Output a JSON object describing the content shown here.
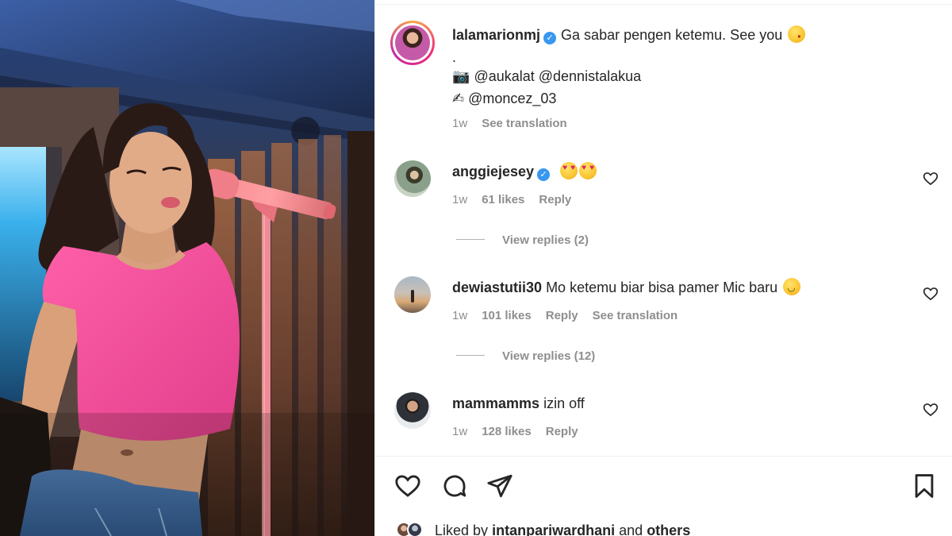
{
  "post": {
    "image_alt_note": "",
    "caption": {
      "username": "lalamarionmj",
      "verified": true,
      "text": "Ga sabar pengen ketemu. See you",
      "emoji": "kiss-emoji",
      "dot": ".",
      "credit_1_icon": "📷",
      "credit_1": "@aukalat @dennistalakua",
      "credit_2_icon": "✍",
      "credit_2": "@moncez_03",
      "time": "1w",
      "see_translation": "See translation"
    },
    "comments": [
      {
        "username": "anggiejesey",
        "verified": true,
        "text": "",
        "emoji": "heart-eyes-emoji x2",
        "time": "1w",
        "likes": "61 likes",
        "reply": "Reply",
        "view_replies": "View replies (2)"
      },
      {
        "username": "dewiastutii30",
        "verified": false,
        "text": "Mo ketemu biar bisa pamer Mic baru",
        "emoji": "rolling-laugh-emoji",
        "time": "1w",
        "likes": "101 likes",
        "reply": "Reply",
        "see_translation": "See translation",
        "view_replies": "View replies (12)"
      },
      {
        "username": "mammamms",
        "verified": false,
        "text": "izin off",
        "time": "1w",
        "likes": "128 likes",
        "reply": "Reply"
      }
    ],
    "liked_by": {
      "prefix": "Liked by",
      "user": "intanpariwardhani",
      "and": "and",
      "others": "others"
    }
  },
  "icons": {
    "like": "heart-icon",
    "comment": "comment-icon",
    "share": "paper-plane-icon",
    "save": "bookmark-icon"
  },
  "colors": {
    "text": "#262626",
    "muted": "#8e8e8e",
    "verified": "#3897f0"
  }
}
